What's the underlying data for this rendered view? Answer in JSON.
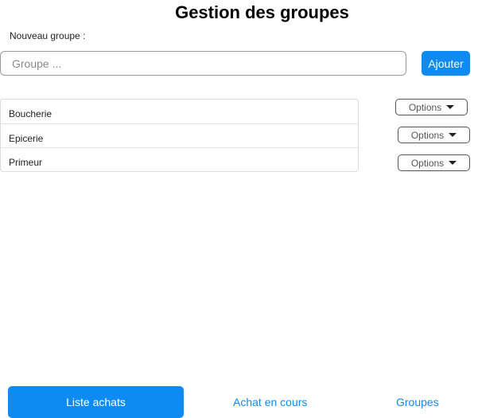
{
  "page": {
    "title": "Gestion des groupes"
  },
  "form": {
    "label": "Nouveau groupe :",
    "input_placeholder": "Groupe ...",
    "input_value": "",
    "add_label": "Ajouter"
  },
  "groups": [
    {
      "name": "Boucherie",
      "options_label": "Options"
    },
    {
      "name": "Epicerie",
      "options_label": "Options"
    },
    {
      "name": "Primeur",
      "options_label": "Options"
    }
  ],
  "bottom_nav": {
    "items": [
      {
        "label": "Liste achats",
        "active": true
      },
      {
        "label": "Achat en cours",
        "active": false
      },
      {
        "label": "Groupes",
        "active": false
      }
    ]
  },
  "colors": {
    "accent": "#0d8bf2"
  }
}
